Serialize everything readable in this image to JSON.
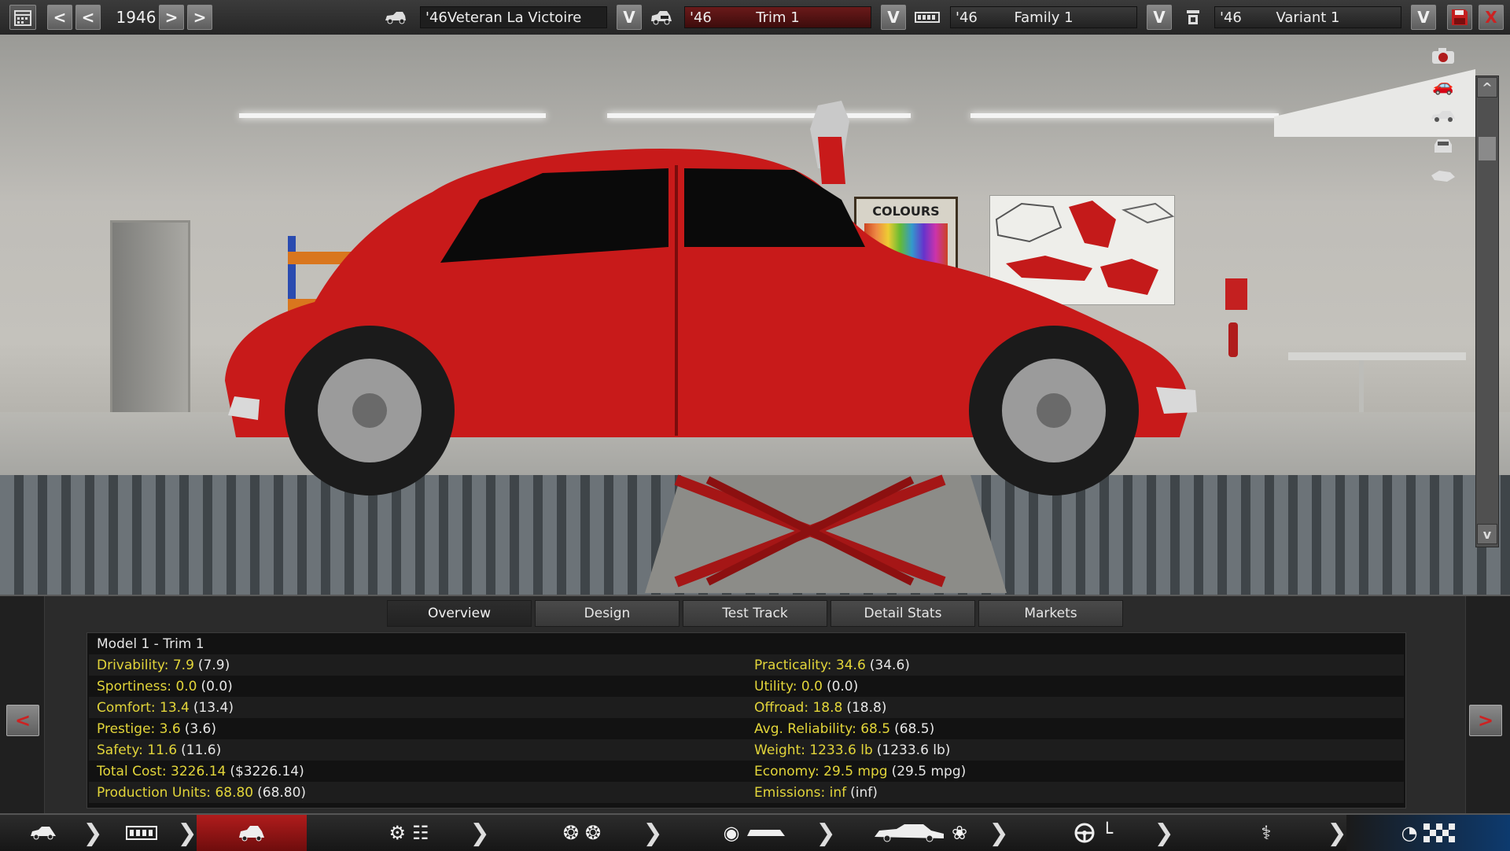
{
  "topbar": {
    "year": "1946",
    "model": {
      "year_prefix": "'46",
      "name": "Veteran La Victoire"
    },
    "trim": {
      "year_prefix": "'46",
      "name": "Trim 1"
    },
    "family": {
      "year_prefix": "'46",
      "name": "Family 1"
    },
    "variant": {
      "year_prefix": "'46",
      "name": "Variant 1"
    },
    "dropdown_glyph": "V",
    "prev_glyph": "<",
    "next_glyph": ">",
    "close_glyph": "X"
  },
  "scene": {
    "poster_text": "COLOURS",
    "scroll_up": "^",
    "scroll_down": "v"
  },
  "tabs": [
    {
      "label": "Overview",
      "active": true
    },
    {
      "label": "Design"
    },
    {
      "label": "Test Track"
    },
    {
      "label": "Detail Stats"
    },
    {
      "label": "Markets"
    }
  ],
  "overview": {
    "title": "Model 1 - Trim 1",
    "left": [
      {
        "label": "Drivability: 7.9",
        "paren": "(7.9)"
      },
      {
        "label": "Sportiness: 0.0",
        "paren": "(0.0)"
      },
      {
        "label": "Comfort: 13.4",
        "paren": "(13.4)"
      },
      {
        "label": "Prestige: 3.6",
        "paren": "(3.6)"
      },
      {
        "label": "Safety: 11.6",
        "paren": "(11.6)"
      },
      {
        "label": "Total Cost: 3226.14",
        "paren": "($3226.14)"
      },
      {
        "label": "Production Units: 68.80",
        "paren": "(68.80)"
      }
    ],
    "right": [
      {
        "label": "Practicality: 34.6",
        "paren": "(34.6)"
      },
      {
        "label": "Utility: 0.0",
        "paren": "(0.0)"
      },
      {
        "label": "Offroad: 18.8",
        "paren": "(18.8)"
      },
      {
        "label": "Avg. Reliability: 68.5",
        "paren": "(68.5)"
      },
      {
        "label": "Weight: 1233.6 lb",
        "paren": "(1233.6 lb)"
      },
      {
        "label": "Economy: 29.5 mpg",
        "paren": "(29.5 mpg)"
      },
      {
        "label": "Emissions: inf",
        "paren": "(inf)"
      }
    ],
    "prev_glyph": "<",
    "next_glyph": ">"
  },
  "colors": {
    "accent_red": "#b01c1c",
    "stat_yellow": "#e2d53a",
    "car_red": "#c81a1a"
  }
}
